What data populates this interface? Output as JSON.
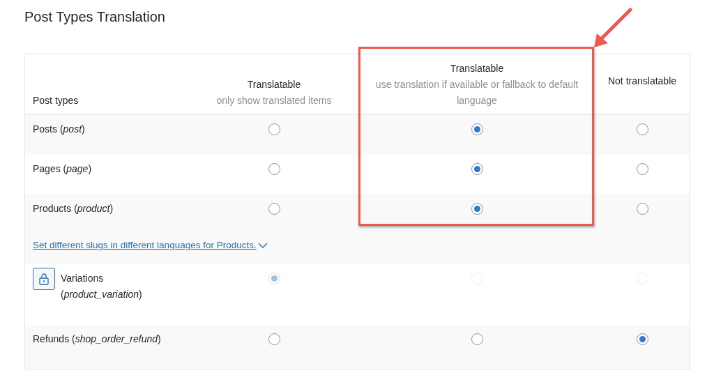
{
  "title": "Post Types Translation",
  "columns": [
    {
      "heading": "Post types"
    },
    {
      "heading": "Translatable",
      "subheading": "only show translated items"
    },
    {
      "heading": "Translatable",
      "subheading": "use translation if available or fallback to default language"
    },
    {
      "heading": "Not translatable"
    }
  ],
  "rows": [
    {
      "kind": "type",
      "label": "Posts (*post*)",
      "locked": false,
      "options": [
        {
          "selected": false,
          "disabled": false
        },
        {
          "selected": true,
          "disabled": false
        },
        {
          "selected": false,
          "disabled": false
        }
      ]
    },
    {
      "kind": "type",
      "label": "Pages (*page*)",
      "locked": false,
      "options": [
        {
          "selected": false,
          "disabled": false
        },
        {
          "selected": true,
          "disabled": false
        },
        {
          "selected": false,
          "disabled": false
        }
      ]
    },
    {
      "kind": "type",
      "label": "Products (*product*)",
      "locked": false,
      "options": [
        {
          "selected": false,
          "disabled": false
        },
        {
          "selected": true,
          "disabled": false
        },
        {
          "selected": false,
          "disabled": false
        }
      ]
    },
    {
      "kind": "link",
      "label": "Set different slugs in different languages for Products."
    },
    {
      "kind": "type",
      "label": "Variations (*product_variation*)",
      "locked": true,
      "options": [
        {
          "selected": true,
          "disabled": true
        },
        {
          "selected": false,
          "disabled": true
        },
        {
          "selected": false,
          "disabled": true
        }
      ]
    },
    {
      "kind": "type",
      "label": "Refunds (*shop_order_refund*)",
      "locked": false,
      "options": [
        {
          "selected": false,
          "disabled": false
        },
        {
          "selected": false,
          "disabled": false
        },
        {
          "selected": true,
          "disabled": false
        }
      ]
    }
  ]
}
